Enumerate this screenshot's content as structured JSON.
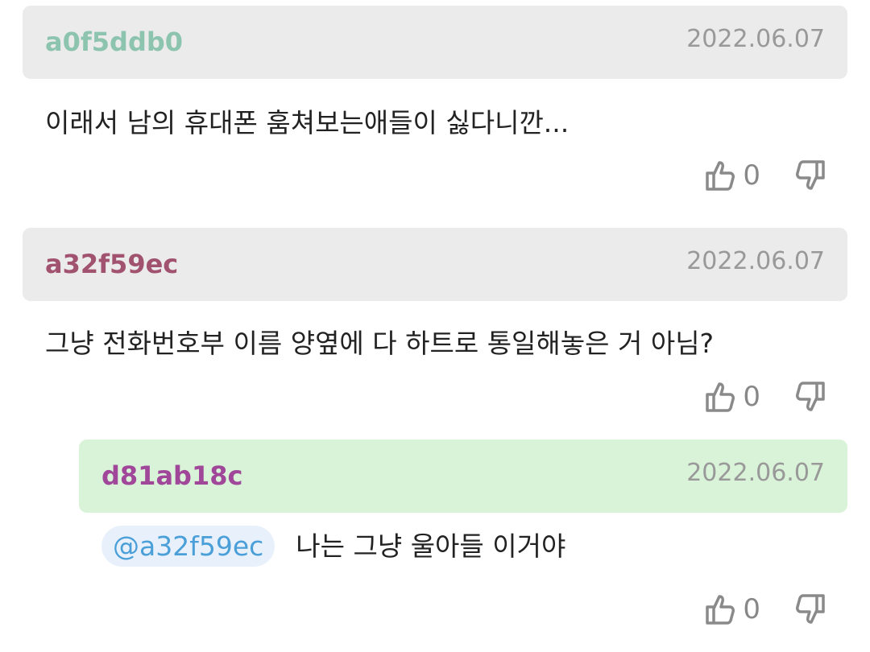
{
  "comments": [
    {
      "author": "a0f5ddb0",
      "author_color": "#8cc4b0",
      "date": "2022.06.07",
      "text": "이래서 남의 휴대폰 훔쳐보는애들이 싫다니깐...",
      "likes": "0"
    },
    {
      "author": "a32f59ec",
      "author_color": "#a0526e",
      "date": "2022.06.07",
      "text": "그냥 전화번호부 이름 양옆에 다 하트로 통일해놓은 거 아님?",
      "likes": "0"
    },
    {
      "author": "d81ab18c",
      "author_color": "#a0479a",
      "date": "2022.06.07",
      "mention": "@a32f59ec",
      "text": "나는 그냥 울아들 이거야",
      "likes": "0"
    }
  ],
  "icons": {
    "like": "thumbs-up-icon",
    "dislike": "thumbs-down-icon"
  }
}
